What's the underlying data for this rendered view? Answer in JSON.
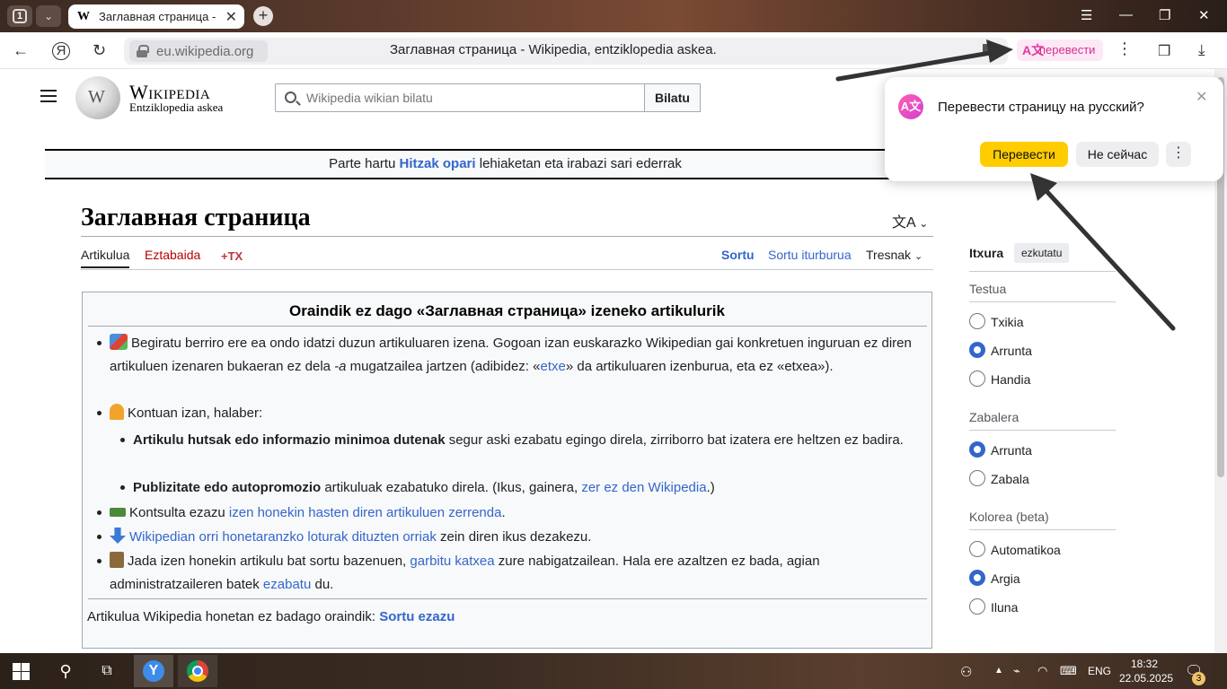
{
  "browser": {
    "tab_counter": "1",
    "tab_title": "Заглавная страница - Wikipedia",
    "tab_favicon": "W",
    "tab_close": "✕",
    "new_tab": "+",
    "url_domain": "eu.wikipedia.org",
    "page_title": "Заглавная страница - Wikipedia, entziklopedia askea.",
    "translate_label": "перевести",
    "translate_icon": "A文",
    "window_controls": {
      "menu": "☰",
      "minimize": "—",
      "restore": "❐",
      "close": "✕"
    }
  },
  "wiki": {
    "wordmark": "Wikipedia",
    "tagline": "Entziklopedia askea",
    "search_placeholder": "Wikipedia wikian bilatu",
    "search_button": "Bilatu",
    "banner": {
      "before": "Parte hartu ",
      "link": "Hitzak opari",
      "after": " lehiaketan eta irabazi sari ederrak"
    },
    "page_heading": "Заглавная страница",
    "lang_icon": "文A",
    "tabs": {
      "artikulua": "Artikulua",
      "eztabaida": "Eztabaida",
      "tx": "+TX",
      "sortu": "Sortu",
      "sortu_iturburua": "Sortu iturburua",
      "tresnak": "Tresnak"
    }
  },
  "notice": {
    "title": "Oraindik ez dago «Заглавная страница» izeneko artikulurik",
    "item1": {
      "text_a": "Begiratu berriro ere ea ondo idatzi duzun artikuluaren izena. Gogoan izan euskarazko Wikipedian gai konkretuen inguruan ez diren artikuluen izenaren bukaeran ez dela ",
      "text_em": "-a",
      "text_b": " mugatzailea jartzen (adibidez: «",
      "link": "etxe",
      "text_c": "» da artikuluaren izenburua, eta ez «etxea»)."
    },
    "item2": "Kontuan izan, halaber:",
    "sub1": {
      "bold": "Artikulu hutsak edo informazio minimoa dutenak",
      "text": " segur aski ezabatu egingo direla, zirriborro bat izatera ere heltzen ez badira."
    },
    "sub2": {
      "bold": "Publizitate edo autopromozio",
      "text": " artikuluak ezabatuko direla. (Ikus, gainera, ",
      "link": "zer ez den Wikipedia",
      "end": ".)"
    },
    "item3": {
      "text": "Kontsulta ezazu ",
      "link": "izen honekin hasten diren artikuluen zerrenda",
      "end": "."
    },
    "item4": {
      "link": "Wikipedian orri honetaranzko loturak dituzten orriak",
      "text": " zein diren ikus dezakezu."
    },
    "item5": {
      "text_a": "Jada izen honekin artikulu bat sortu bazenuen, ",
      "link1": "garbitu katxea",
      "text_b": " zure nabigatzailean. Hala ere azaltzen ez bada, agian administratzaileren batek ",
      "link2": "ezabatu",
      "text_c": " du."
    },
    "footer": {
      "text": "Artikulua Wikipedia honetan ez badago oraindik: ",
      "link": "Sortu ezazu"
    }
  },
  "appearance": {
    "title": "Itxura",
    "hide": "ezkutatu",
    "text_section": "Testua",
    "text_options": [
      "Txikia",
      "Arrunta",
      "Handia"
    ],
    "text_selected": 1,
    "width_section": "Zabalera",
    "width_options": [
      "Arrunta",
      "Zabala"
    ],
    "width_selected": 0,
    "color_section": "Kolorea (beta)",
    "color_options": [
      "Automatikoa",
      "Argia",
      "Iluna"
    ],
    "color_selected": 1
  },
  "popup": {
    "icon": "A文",
    "question": "Перевести страницу на русский?",
    "translate_button": "Перевести",
    "not_now_button": "Не сейчас",
    "more": "⋮",
    "close": "✕"
  },
  "taskbar": {
    "language": "ENG",
    "time": "18:32",
    "date": "22.05.2025",
    "notifications": "3",
    "yandex_letter": "Y"
  },
  "colors": {
    "link": "#3366cc",
    "redlink": "#ba0000",
    "popup_primary": "#ffcc00",
    "translate_accent": "#d4308f"
  }
}
